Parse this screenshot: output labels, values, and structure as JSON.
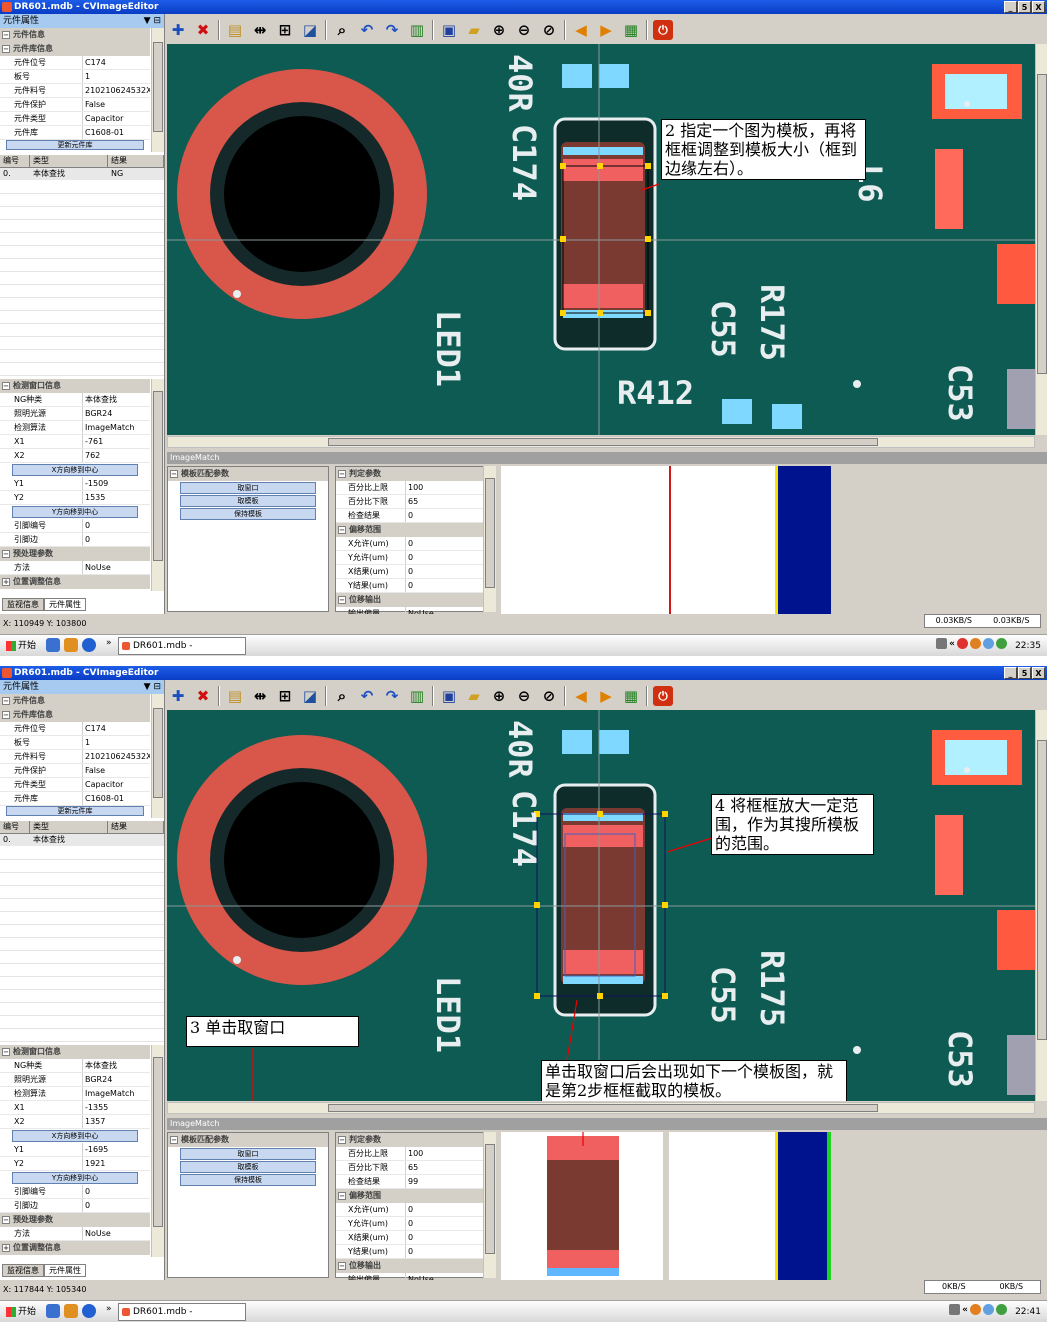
{
  "window": {
    "title": "DR601.mdb - CVImageEditor",
    "buttons": [
      "_",
      "5",
      "X"
    ]
  },
  "panel": {
    "header": "元件属性",
    "pin": "▼ ⊟"
  },
  "props": {
    "cat_info": "元件信息",
    "cat_lib": "元件库信息",
    "rows": [
      {
        "k": "元件位号",
        "v": "C174"
      },
      {
        "k": "板号",
        "v": "1"
      },
      {
        "k": "元件料号",
        "v": "210210624532X"
      },
      {
        "k": "元件保护",
        "v": "False"
      },
      {
        "k": "元件类型",
        "v": "Capacitor"
      },
      {
        "k": "元件库",
        "v": "C1608-01"
      }
    ],
    "update_btn": "更新元件库"
  },
  "table": {
    "headers": [
      "编号",
      "类型",
      "结果"
    ],
    "row1": [
      "0.",
      "本体查找",
      "NG"
    ],
    "row2": [
      "0.",
      "本体查找",
      ""
    ]
  },
  "detect": {
    "cat_win": "检测窗口信息",
    "rows_a": [
      {
        "k": "NG种类",
        "v": "本体查找"
      },
      {
        "k": "照明光源",
        "v": "BGR24"
      },
      {
        "k": "检测算法",
        "v": "ImageMatch"
      }
    ],
    "x1_label": "X1",
    "x2_label": "X2",
    "x_center_btn": "X方向移到中心",
    "y1_label": "Y1",
    "y2_label": "Y2",
    "y_center_btn": "Y方向移到中心",
    "pin_no": "引脚编号",
    "pin_no_v": "0",
    "pin_edge": "引脚边",
    "pin_edge_v": "0",
    "cat_pre": "预处理参数",
    "method": "方法",
    "method_v": "NoUse",
    "cat_pos": "位置调整信息"
  },
  "shot1": {
    "x1": "-761",
    "x2": "762",
    "y1": "-1509",
    "y2": "1535",
    "coords": "X: 110949 Y: 103800",
    "time": "22:35",
    "net_down": "0.03KB/S",
    "net_up": "0.03KB/S",
    "result": "0"
  },
  "shot2": {
    "x1": "-1355",
    "x2": "1357",
    "y1": "-1695",
    "y2": "1921",
    "coords": "X: 117844 Y: 105340",
    "time": "22:41",
    "net_down": "0KB/S",
    "net_up": "0KB/S",
    "result": "99"
  },
  "tabs": [
    "监视信息",
    "元件属性"
  ],
  "imagematch": {
    "header": "ImageMatch",
    "cat_tpl": "模板匹配参数",
    "btns": [
      "取窗口",
      "取模板",
      "保持模板"
    ],
    "cat_judge": "判定参数",
    "judge_rows": [
      {
        "k": "百分比上限",
        "v": "100"
      },
      {
        "k": "百分比下限",
        "v": "65"
      },
      {
        "k": "检查结果"
      }
    ],
    "cat_offset": "偏移范围",
    "offset_rows": [
      {
        "k": "X允许(um)",
        "v": "0"
      },
      {
        "k": "Y允许(um)",
        "v": "0"
      },
      {
        "k": "X结果(um)",
        "v": "0"
      },
      {
        "k": "Y结果(um)",
        "v": "0"
      }
    ],
    "cat_out": "位移输出",
    "out_row": {
      "k": "输出偏量",
      "v": "NoUse"
    }
  },
  "pcb": {
    "c174": "C174",
    "led1": "LED1",
    "c55": "C55",
    "r175": "R175",
    "r412": "R412",
    "c53": "C53",
    "lo": "40R",
    "l6": "L6"
  },
  "callouts": {
    "step2": "2 指定一个图为模板，再将框框调整到模板大小（框到边缘左右）。",
    "step3": "3 单击取窗口",
    "step4": "4 将框框放大一定范围，作为其搜所模板的范围。",
    "note": "单击取窗口后会出现如下一个模板图，就是第2步框框截取的模板。"
  },
  "taskbar": {
    "start": "开始",
    "item": "DR601.mdb - CVImageE...",
    "arrows": "»",
    "tray_arrows": "«"
  },
  "colors": {
    "pcb": "#0d5b52",
    "pad_ring": "#d8564a",
    "title": "#0a3cc4",
    "match_blue": "#00138f",
    "match_yellow": "#f5e400",
    "match_green": "#1ed21e",
    "match_red": "#d01818"
  },
  "icons": [
    "add-icon",
    "delete-icon",
    "open-icon",
    "fit-icon",
    "zoom-fit-icon",
    "select-icon",
    "search-icon",
    "undo-icon",
    "redo-icon",
    "book-icon",
    "save-icon",
    "folder-icon",
    "zoom-in-icon",
    "zoom-out-icon",
    "zoom-window-icon",
    "prev-icon",
    "next-icon",
    "export-icon",
    "power-icon"
  ]
}
